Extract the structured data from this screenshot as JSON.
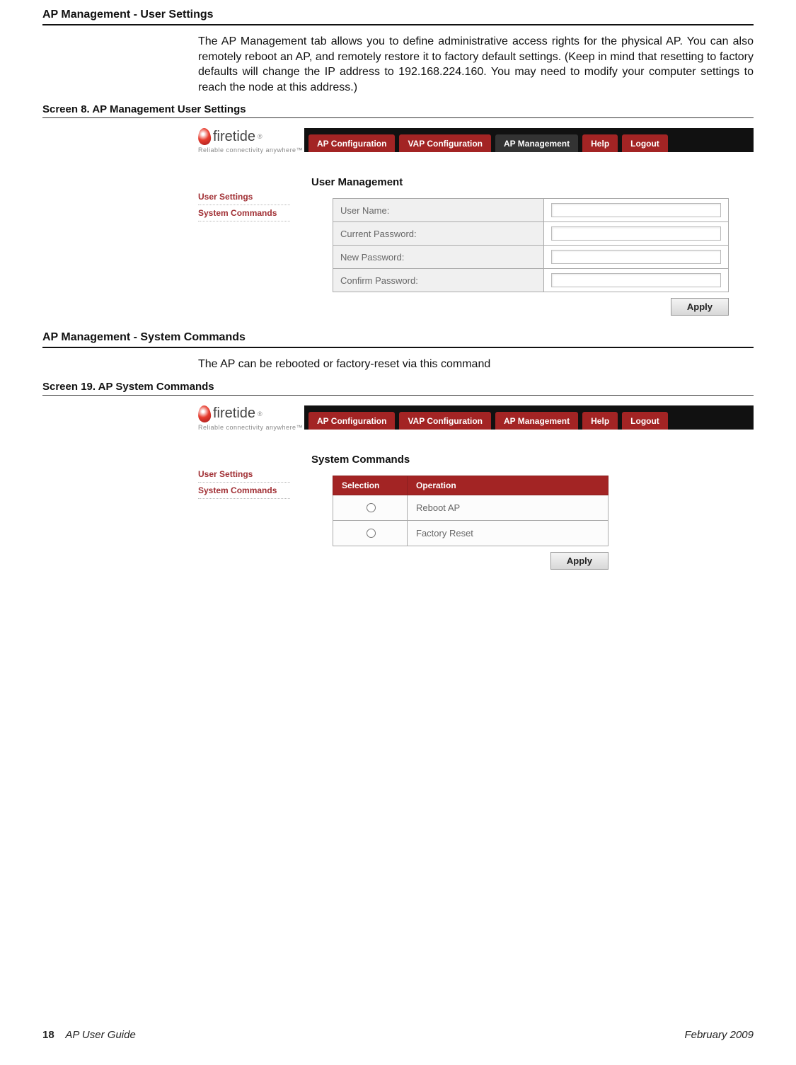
{
  "section1": {
    "title": "AP Management - User Settings",
    "body": "The AP Management tab allows you to define administrative access rights for the physical AP. You can also remotely reboot an AP, and remotely restore it to factory default settings. (Keep in mind that resetting to factory defaults will change the IP address to 192.168.224.160. You may need to modify your computer settings to reach the node at this address.)",
    "caption": "Screen 8. AP Management User Settings"
  },
  "screenshot1": {
    "logo_text": "firetide",
    "logo_sub": "Reliable connectivity anywhere™",
    "tabs": {
      "ap_config": "AP Configuration",
      "vap_config": "VAP Configuration",
      "ap_mgmt": "AP Management",
      "help": "Help",
      "logout": "Logout"
    },
    "sidenav": {
      "user_settings": "User Settings",
      "system_commands": "System Commands"
    },
    "panel_title": "User Management",
    "fields": {
      "user_name": "User Name:",
      "current_password": "Current Password:",
      "new_password": "New Password:",
      "confirm_password": "Confirm Password:"
    },
    "apply": "Apply"
  },
  "section2": {
    "title": "AP Management - System Commands",
    "body": "The AP can be rebooted or factory-reset via this command",
    "caption": "Screen 19. AP System Commands"
  },
  "screenshot2": {
    "logo_text": "firetide",
    "logo_sub": "Reliable connectivity anywhere™",
    "tabs": {
      "ap_config": "AP Configuration",
      "vap_config": "VAP Configuration",
      "ap_mgmt": "AP Management",
      "help": "Help",
      "logout": "Logout"
    },
    "sidenav": {
      "user_settings": "User Settings",
      "system_commands": "System Commands"
    },
    "panel_title": "System Commands",
    "headers": {
      "selection": "Selection",
      "operation": "Operation"
    },
    "ops": {
      "reboot": "Reboot AP",
      "reset": "Factory Reset"
    },
    "apply": "Apply"
  },
  "footer": {
    "page_num": "18",
    "doc_title": "AP User Guide",
    "date": "February 2009"
  }
}
